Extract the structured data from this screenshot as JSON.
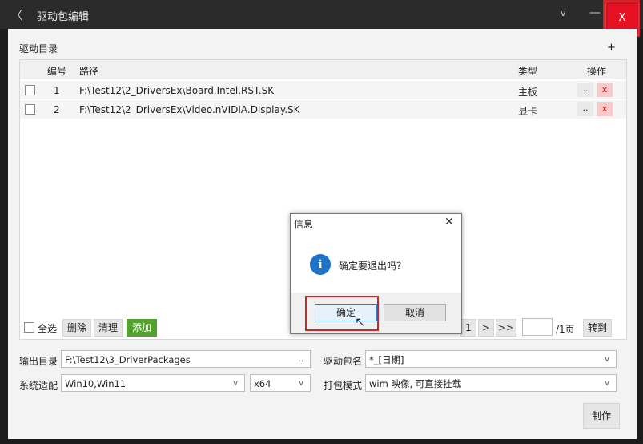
{
  "title_bar": {
    "back_glyph": "〈",
    "title": "驱动包编辑",
    "collapse_glyph": "v",
    "minimize_glyph": "—",
    "close_glyph": "X"
  },
  "section": {
    "label": "驱动目录",
    "add_glyph": "+"
  },
  "table": {
    "headers": {
      "num": "编号",
      "path": "路径",
      "type": "类型",
      "ops": "操作"
    },
    "rows": [
      {
        "num": "1",
        "path": "F:\\Test12\\2_DriversEx\\Board.Intel.RST.SK",
        "type": "主板",
        "edit": "..",
        "remove": "x"
      },
      {
        "num": "2",
        "path": "F:\\Test12\\2_DriversEx\\Video.nVIDIA.Display.SK",
        "type": "显卡",
        "edit": "..",
        "remove": "x"
      }
    ]
  },
  "list_actions": {
    "select_all": "全选",
    "delete": "删除",
    "clear": "清理",
    "add": "添加"
  },
  "pager": {
    "current": "1",
    "next": ">",
    "last": ">>",
    "page_input": "",
    "total": "/1页",
    "goto": "转到"
  },
  "form": {
    "output_dir_label": "输出目录",
    "output_dir_value": "F:\\Test12\\3_DriverPackages",
    "output_dir_browse": "..",
    "pkg_name_label": "驱动包名",
    "pkg_name_value": "*_[日期]",
    "system_label": "系统适配",
    "system_value": "Win10,Win11",
    "arch_value": "x64",
    "mode_label": "打包模式",
    "mode_value": "wim 映像, 可直接挂载",
    "dropdown_glyph": "v",
    "make_button": "制作"
  },
  "dialog": {
    "title": "信息",
    "close_glyph": "X",
    "icon_glyph": "i",
    "message": "确定要退出吗？",
    "ok": "确定",
    "cancel": "取消"
  },
  "colors": {
    "accent_green": "#52a22d",
    "close_red": "#e81123",
    "highlight_red": "#d0232a",
    "info_blue": "#1f74c7"
  }
}
